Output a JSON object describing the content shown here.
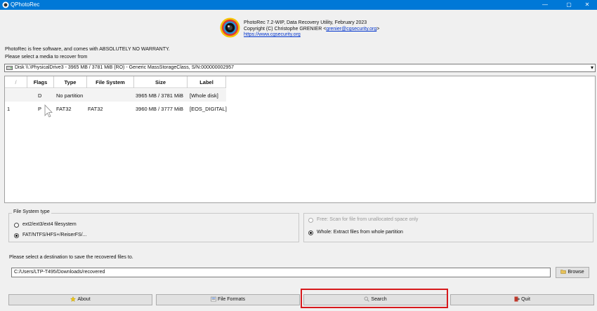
{
  "window": {
    "title": "QPhotoRec",
    "min_glyph": "—",
    "max_glyph": "▢",
    "close_glyph": "✕"
  },
  "header": {
    "line1": "PhotoRec 7.2-WIP, Data Recovery Utility, February 2023",
    "line2_prefix": "Copyright (C) Christophe GRENIER <",
    "email": "grenier@cgsecurity.org",
    "line2_suffix": ">",
    "website": "https://www.cgsecurity.org"
  },
  "notices": {
    "warranty": "PhotoRec is free software, and comes with ABSOLUTELY NO WARRANTY.",
    "select_media": "Please select a media to recover from"
  },
  "disk": {
    "selected": "Disk \\\\.\\PhysicalDrive3 - 3965 MB / 3781 MiB (RO) - Generic MassStorageClass, S/N:000000002957",
    "arrow": "▾"
  },
  "table": {
    "headers": {
      "corner": "/",
      "flags": "Flags",
      "type": "Type",
      "fs": "File System",
      "size": "Size",
      "label": "Label"
    },
    "rows": [
      {
        "num": "",
        "flags": "D",
        "type": "No partition",
        "fs": "",
        "size": "3965 MB / 3781 MiB",
        "label": "[Whole disk]"
      },
      {
        "num": "1",
        "flags": "P",
        "type": "FAT32",
        "fs": "FAT32",
        "size": "3960 MB / 3777 MiB",
        "label": "[EOS_DIGITAL]"
      }
    ]
  },
  "fs_type": {
    "legend": "File System type",
    "options": [
      {
        "label": "ext2/ext3/ext4 filesystem",
        "checked": false
      },
      {
        "label": "FAT/NTFS/HFS+/ReiserFS/...",
        "checked": true
      }
    ]
  },
  "scan_mode": {
    "options": [
      {
        "label": "Free: Scan for file from unallocated space only",
        "checked": false,
        "enabled": false
      },
      {
        "label": "Whole: Extract files from whole partition",
        "checked": true,
        "enabled": true
      }
    ]
  },
  "destination": {
    "label": "Please select a destination to save the recovered files to.",
    "value": "C:/Users/LTP-T495/Downloads/recovered",
    "browse": "Browse"
  },
  "buttons": {
    "about": "About",
    "formats": "File Formats",
    "search": "Search",
    "quit": "Quit"
  },
  "colors": {
    "titlebar": "#0078d7",
    "highlight": "#d7191c",
    "link": "#0033cc"
  }
}
